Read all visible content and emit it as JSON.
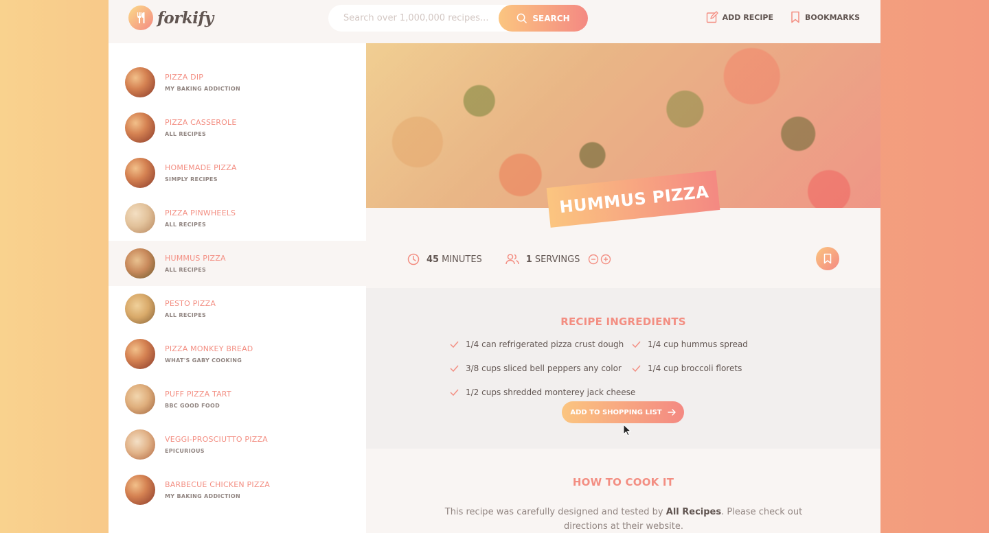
{
  "header": {
    "logo_text": "forkify",
    "search_placeholder": "Search over 1,000,000 recipes...",
    "search_button": "SEARCH",
    "nav": {
      "add_recipe": "ADD RECIPE",
      "bookmarks": "BOOKMARKS"
    }
  },
  "results": [
    {
      "title": "PIZZA DIP",
      "publisher": "MY BAKING ADDICTION"
    },
    {
      "title": "PIZZA CASSEROLE",
      "publisher": "ALL RECIPES"
    },
    {
      "title": "HOMEMADE PIZZA",
      "publisher": "SIMPLY RECIPES"
    },
    {
      "title": "PIZZA PINWHEELS",
      "publisher": "ALL RECIPES"
    },
    {
      "title": "HUMMUS PIZZA",
      "publisher": "ALL RECIPES"
    },
    {
      "title": "PESTO PIZZA",
      "publisher": "ALL RECIPES"
    },
    {
      "title": "PIZZA MONKEY BREAD",
      "publisher": "WHAT'S GABY COOKING"
    },
    {
      "title": "PUFF PIZZA TART",
      "publisher": "BBC GOOD FOOD"
    },
    {
      "title": "VEGGI-PROSCIUTTO PIZZA",
      "publisher": "EPICURIOUS"
    },
    {
      "title": "BARBECUE CHICKEN PIZZA",
      "publisher": "MY BAKING ADDICTION"
    }
  ],
  "recipe": {
    "title": "HUMMUS PIZZA",
    "minutes_value": "45",
    "minutes_label": "MINUTES",
    "servings_value": "1",
    "servings_label": "SERVINGS",
    "ingredients_heading": "RECIPE INGREDIENTS",
    "ingredients": [
      "1/4 can refrigerated pizza crust dough",
      "1/4 cup hummus spread",
      "3/8 cups sliced bell peppers any color",
      "1/4 cup broccoli florets",
      "1/2 cups shredded monterey jack cheese"
    ],
    "shopping_button": "ADD TO SHOPPING LIST",
    "directions_heading": "HOW TO COOK IT",
    "directions_text_before": "This recipe was carefully designed and tested by ",
    "directions_publisher": "All Recipes",
    "directions_text_after": ". Please check out directions at their website."
  },
  "colors": {
    "accent": "#f38e82",
    "gradient_start": "#fbdb89",
    "gradient_end": "#f48982"
  }
}
